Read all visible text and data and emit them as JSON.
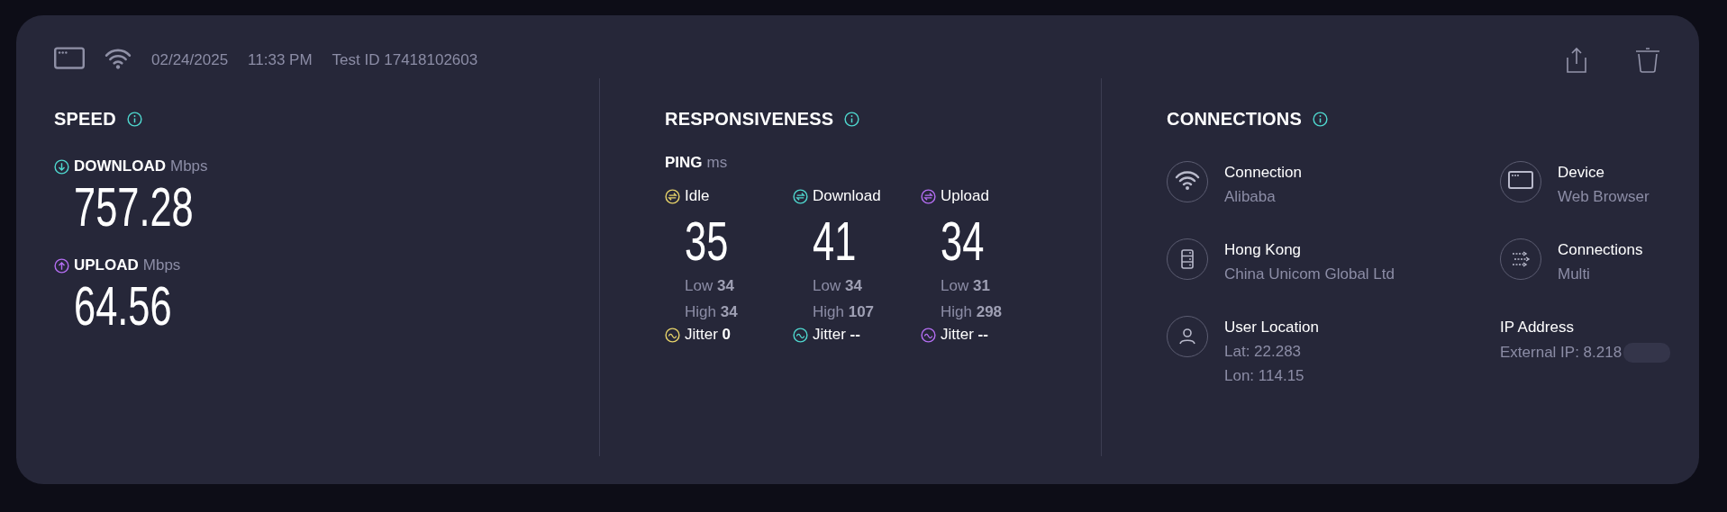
{
  "header": {
    "date": "02/24/2025",
    "time": "11:33 PM",
    "test_id": "Test ID 17418102603"
  },
  "speed": {
    "title": "SPEED",
    "metrics": [
      {
        "kind": "download",
        "label": "DOWNLOAD",
        "unit": "Mbps",
        "value": "757.28",
        "color": "#4fd8cf"
      },
      {
        "kind": "upload",
        "label": "UPLOAD",
        "unit": "Mbps",
        "value": "64.56",
        "color": "#b46ef2"
      }
    ]
  },
  "responsiveness": {
    "title": "RESPONSIVENESS",
    "ping_label": "PING",
    "ping_unit": "ms",
    "columns": [
      {
        "label": "Idle",
        "color": "#e8d46a",
        "value": "35",
        "low": "Low **34**",
        "high": "High **34**",
        "jitter": "Jitter **0**"
      },
      {
        "label": "Download",
        "color": "#4fd8cf",
        "value": "41",
        "low": "Low **34**",
        "high": "High **107**",
        "jitter": "Jitter **--**"
      },
      {
        "label": "Upload",
        "color": "#b46ef2",
        "value": "34",
        "low": "Low **31**",
        "high": "High **298**",
        "jitter": "Jitter **--**"
      }
    ]
  },
  "connections": {
    "title": "CONNECTIONS",
    "items": [
      {
        "kind": "wifi",
        "title": "Connection",
        "lines": [
          "Alibaba"
        ]
      },
      {
        "kind": "browser",
        "title": "Device",
        "lines": [
          "Web Browser"
        ]
      },
      {
        "kind": "server",
        "title": "Hong Kong",
        "lines": [
          "China Unicom Global Ltd"
        ]
      },
      {
        "kind": "multi",
        "title": "Connections",
        "lines": [
          "Multi"
        ]
      },
      {
        "kind": "person",
        "title": "User Location",
        "lines": [
          "Lat: 22.283",
          "Lon: 114.15"
        ]
      },
      {
        "kind": "redacted",
        "title": "IP Address",
        "lines": [
          "External IP: 8.218"
        ]
      }
    ]
  }
}
